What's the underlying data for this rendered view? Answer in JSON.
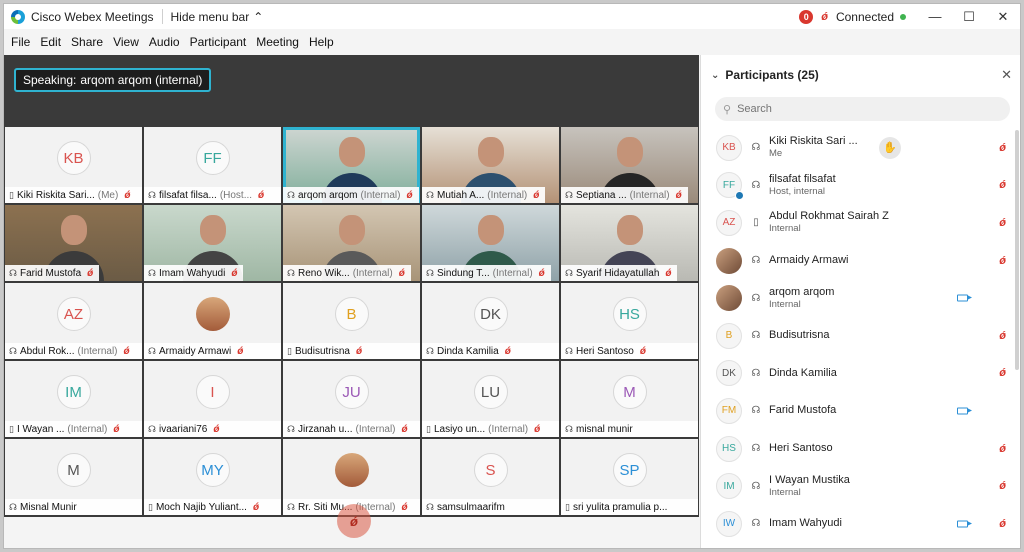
{
  "app": {
    "title": "Cisco Webex Meetings",
    "hide_menu_label": "Hide menu bar",
    "status": "Connected",
    "rec_label": "0"
  },
  "menu": [
    "File",
    "Edit",
    "Share",
    "View",
    "Audio",
    "Participant",
    "Meeting",
    "Help"
  ],
  "stage": {
    "speaking_prefix": "Speaking:",
    "speaking_name": "arqom arqom (internal)"
  },
  "tiles": [
    {
      "initials": "KB",
      "name": "Kiki Riskita Sari...",
      "tag": "(Me)",
      "color": "#d9534f"
    },
    {
      "initials": "FF",
      "name": "filsafat filsa...",
      "tag": "(Host...",
      "color": "#38a89d"
    },
    {
      "initials": "",
      "name": "arqom arqom",
      "tag": "(Internal)",
      "video": true
    },
    {
      "initials": "",
      "name": "Mutiah A...",
      "tag": "(Internal)",
      "video": true
    },
    {
      "initials": "",
      "name": "Septiana ...",
      "tag": "(Internal)",
      "video": true
    },
    {
      "initials": "",
      "name": "Farid Mustofa",
      "tag": "",
      "video": true
    },
    {
      "initials": "",
      "name": "Imam Wahyudi",
      "tag": "",
      "video": true
    },
    {
      "initials": "",
      "name": "Reno Wik...",
      "tag": "(Internal)",
      "video": true
    },
    {
      "initials": "",
      "name": "Sindung T...",
      "tag": "(Internal)",
      "video": true
    },
    {
      "initials": "",
      "name": "Syarif Hidayatullah",
      "tag": "",
      "video": true
    },
    {
      "initials": "AZ",
      "name": "Abdul Rok...",
      "tag": "(Internal)",
      "color": "#d9534f"
    },
    {
      "initials": "",
      "name": "Armaidy Armawi",
      "tag": "",
      "photo": true
    },
    {
      "initials": "B",
      "name": "Budisutrisna",
      "tag": "",
      "color": "#e0a020"
    },
    {
      "initials": "DK",
      "name": "Dinda Kamilia",
      "tag": "",
      "color": "#555555"
    },
    {
      "initials": "HS",
      "name": "Heri Santoso",
      "tag": "",
      "color": "#38a89d"
    },
    {
      "initials": "IM",
      "name": "I Wayan ...",
      "tag": "(Internal)",
      "color": "#38a89d"
    },
    {
      "initials": "I",
      "name": "ivaariani76",
      "tag": "",
      "color": "#d9534f"
    },
    {
      "initials": "JU",
      "name": "Jirzanah u...",
      "tag": "(Internal)",
      "color": "#9b59b6"
    },
    {
      "initials": "LU",
      "name": "Lasiyo un...",
      "tag": "(Internal)",
      "color": "#555555"
    },
    {
      "initials": "M",
      "name": "misnal munir",
      "tag": "",
      "color": "#9b59b6",
      "nomute": true
    },
    {
      "initials": "M",
      "name": "Misnal Munir",
      "tag": "",
      "color": "#555555",
      "nomute": true
    },
    {
      "initials": "MY",
      "name": "Moch Najib Yuliant...",
      "tag": "",
      "color": "#2b8fd6"
    },
    {
      "initials": "",
      "name": "Rr. Siti Mu...",
      "tag": "(Internal)",
      "photo": true
    },
    {
      "initials": "S",
      "name": "samsulmaarifm",
      "tag": "",
      "color": "#d9534f",
      "nomute": true
    },
    {
      "initials": "SP",
      "name": "sri yulita pramulia p...",
      "tag": "",
      "color": "#2b8fd6",
      "nomute": true
    }
  ],
  "panel": {
    "title": "Participants (25)",
    "search_placeholder": "Search",
    "participants": [
      {
        "initials": "KB",
        "name": "Kiki Riskita Sari ...",
        "sub": "Me",
        "color": "#d9534f",
        "mute": true,
        "hand": true
      },
      {
        "initials": "FF",
        "name": "filsafat filsafat",
        "sub": "Host, internal",
        "color": "#38a89d",
        "mute": true,
        "globe": true
      },
      {
        "initials": "AZ",
        "name": "Abdul Rokhmat Sairah Z",
        "sub": "Internal",
        "color": "#d9534f",
        "mute": true
      },
      {
        "initials": "",
        "name": "Armaidy Armawi",
        "sub": "",
        "photo": true,
        "mute": true
      },
      {
        "initials": "",
        "name": "arqom arqom",
        "sub": "Internal",
        "photo": true,
        "cam": true
      },
      {
        "initials": "B",
        "name": "Budisutrisna",
        "sub": "",
        "color": "#e0a020",
        "mute": true
      },
      {
        "initials": "DK",
        "name": "Dinda Kamilia",
        "sub": "",
        "color": "#555555",
        "mute": true
      },
      {
        "initials": "FM",
        "name": "Farid Mustofa",
        "sub": "",
        "color": "#e0a020",
        "cam": true
      },
      {
        "initials": "HS",
        "name": "Heri Santoso",
        "sub": "",
        "color": "#38a89d",
        "mute": true
      },
      {
        "initials": "IM",
        "name": "I Wayan Mustika",
        "sub": "Internal",
        "color": "#38a89d",
        "mute": true
      },
      {
        "initials": "IW",
        "name": "Imam Wahyudi",
        "sub": "",
        "color": "#2b8fd6",
        "cam": true,
        "mute": true
      }
    ]
  }
}
